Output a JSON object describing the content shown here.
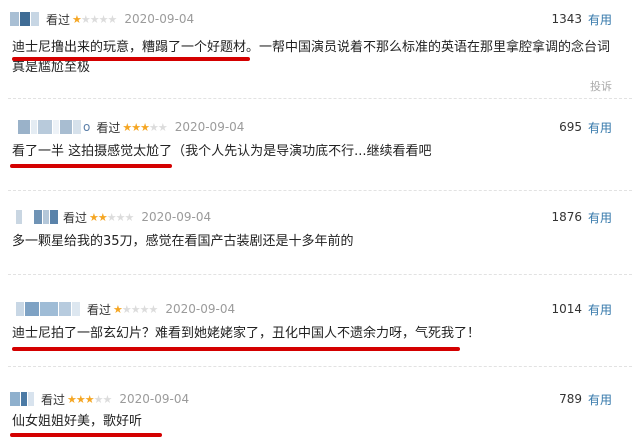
{
  "reviews": [
    {
      "user_tail": "",
      "seen_label": "看过",
      "stars": 1,
      "date": "2020-09-04",
      "votes": "1343",
      "useful_label": "有用",
      "highlight": "迪士尼撸出来的玩意，糟蹋了一个好题材",
      "rest": "。一帮中国演员说着不那么标准的英语在那里拿腔拿调的念台词真是尴尬至极",
      "report_label": "投诉"
    },
    {
      "user_tail": "o",
      "seen_label": "看过",
      "stars": 3,
      "date": "2020-09-04",
      "votes": "695",
      "useful_label": "有用",
      "highlight": "看了一半 这拍摄感觉太尬了",
      "rest": "（我个人先认为是导演功底不行...继续看看吧"
    },
    {
      "user_tail": "",
      "seen_label": "看过",
      "stars": 2,
      "date": "2020-09-04",
      "votes": "1876",
      "useful_label": "有用",
      "highlight": "",
      "rest": "多一颗星给我的35刀，感觉在看国产古装剧还是十多年前的"
    },
    {
      "user_tail": "",
      "seen_label": "看过",
      "stars": 1,
      "date": "2020-09-04",
      "votes": "1014",
      "useful_label": "有用",
      "highlight": "迪士尼拍了一部玄幻片？难看到她姥姥家了，丑化中国人不遗余力呀，气死我了！",
      "rest": ""
    },
    {
      "user_tail": "",
      "seen_label": "看过",
      "stars": 3,
      "date": "2020-09-04",
      "votes": "789",
      "useful_label": "有用",
      "highlight": "仙女姐姐好美，歌好听",
      "rest": ""
    }
  ]
}
